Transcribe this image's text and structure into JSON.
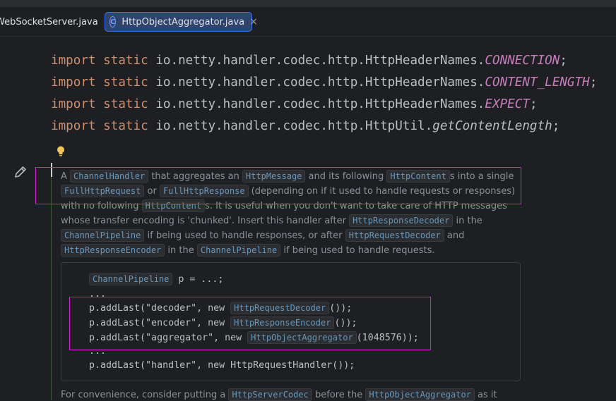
{
  "tabs": [
    {
      "label": "WebSocketServer.java"
    },
    {
      "label": "HttpObjectAggregator.java",
      "icon": "C",
      "close": "×"
    }
  ],
  "imports": [
    {
      "kw1": "import",
      "kw2": "static",
      "path": "io.netty.handler.codec.http.HttpHeaderNames.",
      "member": "CONNECTION",
      "end": ";"
    },
    {
      "kw1": "import",
      "kw2": "static",
      "path": "io.netty.handler.codec.http.HttpHeaderNames.",
      "member": "CONTENT_LENGTH",
      "end": ";"
    },
    {
      "kw1": "import",
      "kw2": "static",
      "path": "io.netty.handler.codec.http.HttpHeaderNames.",
      "member": "EXPECT",
      "end": ";"
    },
    {
      "kw1": "import",
      "kw2": "static",
      "path": "io.netty.handler.codec.http.HttpUtil.",
      "member": "getContentLength",
      "end": ";"
    }
  ],
  "doc": {
    "t0": "A ",
    "c0": "ChannelHandler",
    "t1": " that aggregates an ",
    "c1": "HttpMessage",
    "t2": " and its following ",
    "c2": "HttpContent",
    "t3": "s into a single ",
    "c3": "FullHttpRequest",
    "t4": " or ",
    "c4": "FullHttpResponse",
    "t5": " (depending on if it used to handle requests or responses) with no following ",
    "c5": "HttpContent",
    "t6": "s. It is useful when you don't want to take care of HTTP messages whose transfer encoding is 'chunked'. Insert this handler after ",
    "c6": "HttpResponseDecoder",
    "t7": " in the ",
    "c7": "ChannelPipeline",
    "t8": " if being used to handle responses, or after ",
    "c8": "HttpRequestDecoder",
    "t9": " and ",
    "c9": "HttpResponseEncoder",
    "t10": " in the ",
    "c10": "ChannelPipeline",
    "t11": " if being used to handle requests."
  },
  "codeblock": {
    "l1_type": "ChannelPipeline",
    "l1_rest": " p = ...;",
    "l2": "...",
    "l3_pre": "p.addLast(\"decoder\", ",
    "l3_new": "new ",
    "l3_type": "HttpRequestDecoder",
    "l3_end": "());",
    "l4_pre": "p.addLast(\"encoder\", ",
    "l4_new": "new ",
    "l4_type": "HttpResponseEncoder",
    "l4_end": "());",
    "l5_pre": "p.addLast(\"aggregator\", ",
    "l5_new": "new ",
    "l5_type": "HttpObjectAggregator",
    "l5_end": "(1048576));",
    "l6": "...",
    "l7": "p.addLast(\"handler\", new HttpRequestHandler());"
  },
  "doc2": {
    "t0": "For convenience, consider putting a ",
    "c0": "HttpServerCodec",
    "t1": " before the ",
    "c1": "HttpObjectAggregator",
    "t2": " as it"
  },
  "colors": {
    "highlight": "#d61fd6",
    "accent": "#3574f0"
  }
}
